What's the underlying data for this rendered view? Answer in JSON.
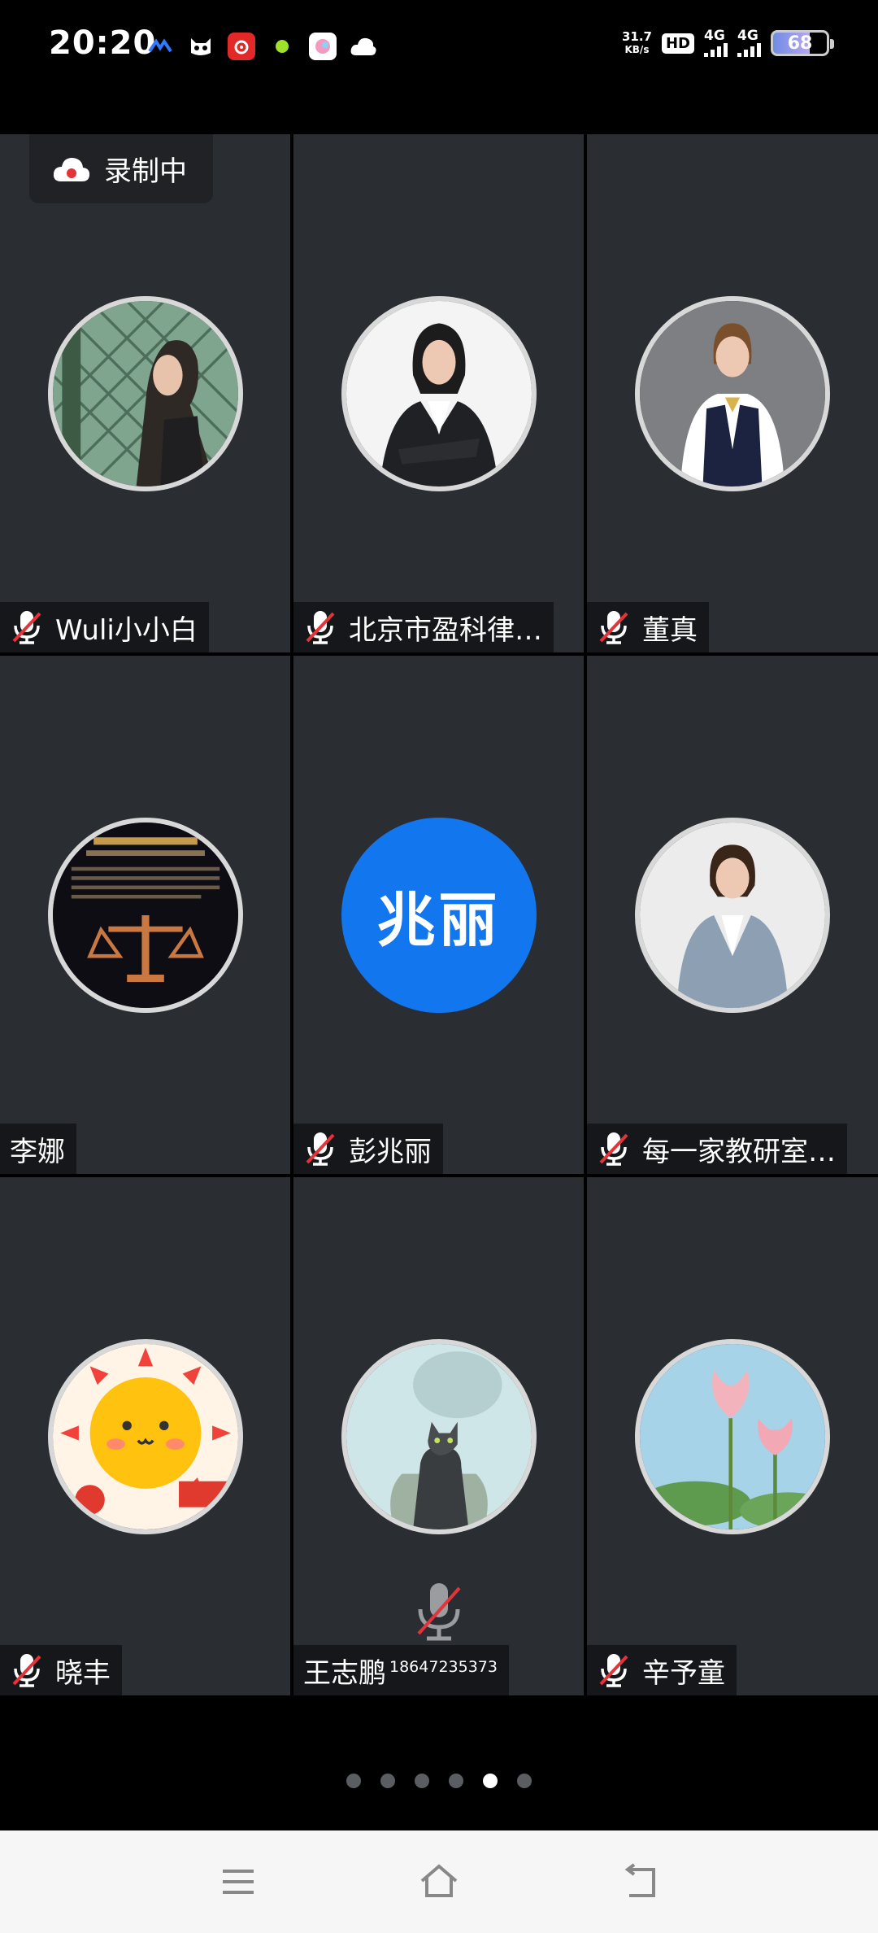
{
  "status_bar": {
    "time": "20:20",
    "net_speed_value": "31.7",
    "net_speed_unit": "KB/s",
    "hd_label": "HD",
    "network_1": "4G",
    "network_2": "4G",
    "battery_level": "68",
    "app_icons": [
      "brand-icon",
      "cat-icon",
      "music-icon",
      "dot-icon",
      "photo-icon",
      "cloud-icon"
    ]
  },
  "recording": {
    "label": "录制中"
  },
  "participants": [
    {
      "name": "Wuli小小白",
      "muted": true,
      "avatar": "photo-girl-fence"
    },
    {
      "name": "北京市盈科律…",
      "muted": true,
      "avatar": "photo-woman-suit"
    },
    {
      "name": "董真",
      "muted": true,
      "avatar": "photo-woman-uniform"
    },
    {
      "name": "李娜",
      "muted": false,
      "avatar": "law-firm-logo"
    },
    {
      "name": "彭兆丽",
      "muted": true,
      "avatar_initials": "兆丽"
    },
    {
      "name": "每一家教研室…",
      "muted": true,
      "avatar": "photo-woman-grey-suit"
    },
    {
      "name": "晓丰",
      "muted": true,
      "avatar": "cartoon-sun"
    },
    {
      "name": "王志鹏",
      "name_suffix": "18647235373",
      "muted": true,
      "avatar": "cat-tiger"
    },
    {
      "name": "辛予童",
      "muted": true,
      "avatar": "lotus-flowers"
    }
  ],
  "pager": {
    "total": 6,
    "active_index": 4
  },
  "colors": {
    "tile_bg": "#2a2d31",
    "initials_bg": "#1277ef",
    "mute_red": "#e5333a"
  }
}
